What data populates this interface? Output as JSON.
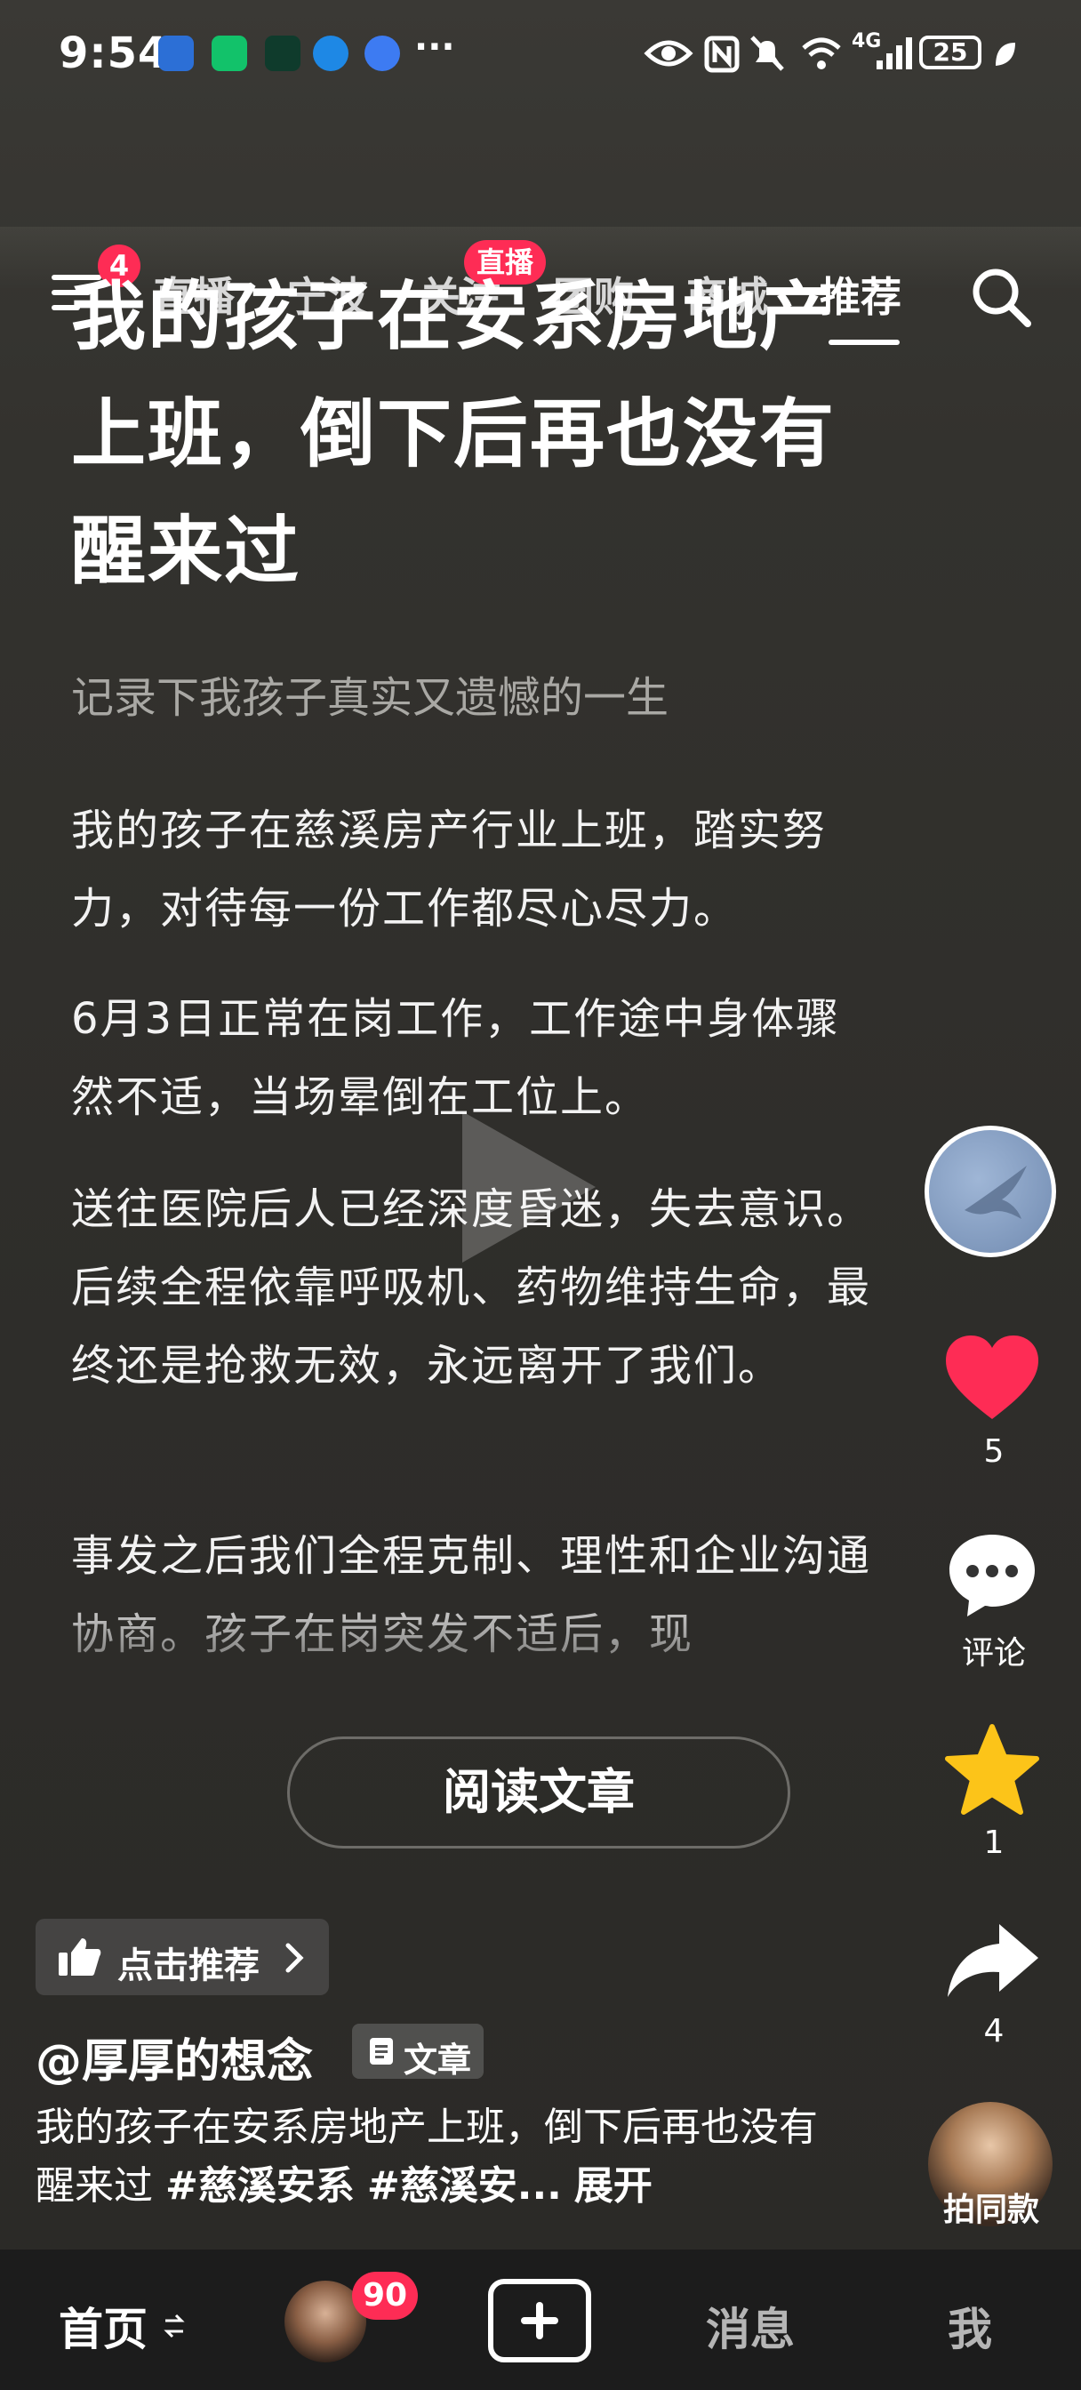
{
  "status_bar": {
    "time": "9:54",
    "more": "···",
    "network": "4G",
    "battery": "25"
  },
  "nav": {
    "menu_badge": "4",
    "tabs": [
      {
        "label": "直播"
      },
      {
        "label": "宁波"
      },
      {
        "label": "关注"
      },
      {
        "label": "团购"
      },
      {
        "label": "商城"
      },
      {
        "label": "推荐",
        "active": true
      }
    ],
    "follow_live_badge": "直播"
  },
  "article": {
    "headline": "我的孩子在安系房地产上班，倒下后再也没有醒来过",
    "subtitle": "记录下我孩子真实又遗憾的一生",
    "paragraphs": [
      "我的孩子在慈溪房产行业上班，踏实努力，对待每一份工作都尽心尽力。",
      "6月3日正常在岗工作，工作途中身体骤然不适，当场晕倒在工位上。",
      "送往医院后人已经深度昏迷，失去意识。后续全程依靠呼吸机、药物维持生命，最终还是抢救无效，永远离开了我们。",
      "事发之后我们全程克制、理性和企业沟通协商。孩子在岗突发不适后，现"
    ],
    "read_button": "阅读文章"
  },
  "rail": {
    "likes": "5",
    "comments_label": "评论",
    "favorites": "1",
    "shares": "4"
  },
  "post": {
    "recommend_label": "点击推荐",
    "author": "@厚厚的想念",
    "type_tag": "文章",
    "caption_text": "我的孩子在安系房地产上班，倒下后再也没有醒来过 ",
    "hashtag1": "#慈溪安系",
    "hashtag2": "#慈溪安...",
    "expand": "展开",
    "same_style_label": "拍同款"
  },
  "bottom_nav": {
    "home": "首页",
    "friends_badge": "90",
    "messages": "消息",
    "me": "我"
  },
  "colors": {
    "accent": "#fe2c55",
    "like": "#fe2c55",
    "star": "#fcc419"
  }
}
